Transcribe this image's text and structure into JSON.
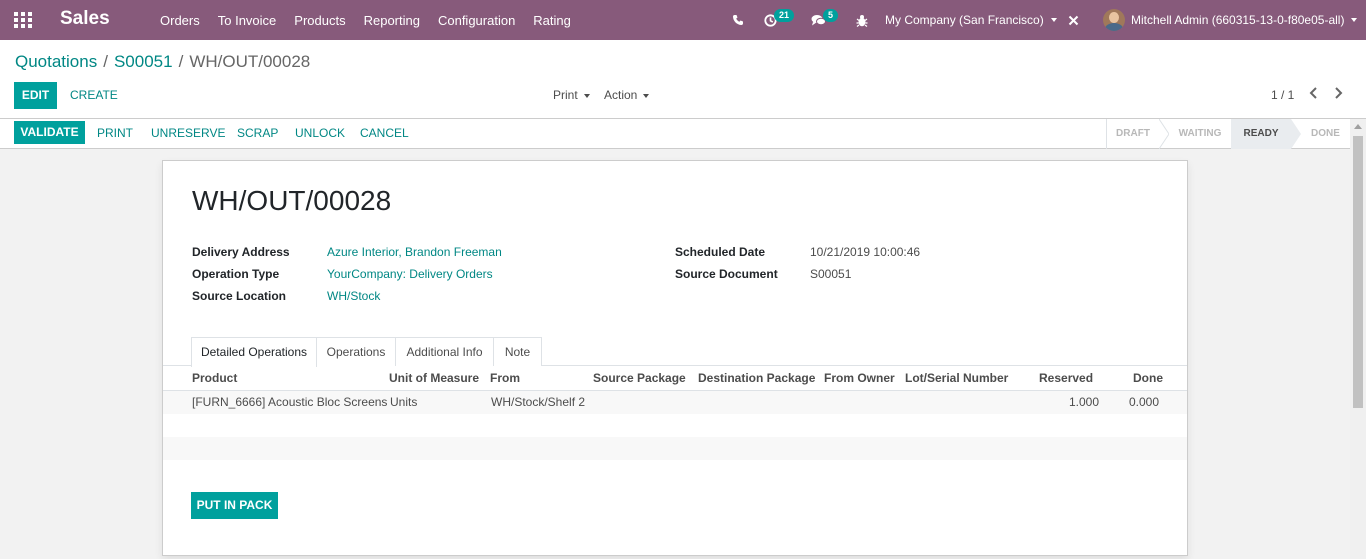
{
  "navbar": {
    "app_name": "Sales",
    "menu": [
      "Orders",
      "To Invoice",
      "Products",
      "Reporting",
      "Configuration",
      "Rating"
    ],
    "activity_count": "21",
    "message_count": "5",
    "company": "My Company (San Francisco)",
    "user": "Mitchell Admin (660315-13-0-f80e05-all)",
    "accent_color": "#875a7b"
  },
  "breadcrumb": {
    "items": [
      "Quotations",
      "S00051"
    ],
    "current": "WH/OUT/00028"
  },
  "control_panel": {
    "edit_label": "EDIT",
    "create_label": "CREATE",
    "print_label": "Print",
    "action_label": "Action",
    "pager": "1 / 1"
  },
  "statusbar": {
    "validate_label": "VALIDATE",
    "buttons": [
      "PRINT",
      "UNRESERVE",
      "SCRAP",
      "UNLOCK",
      "CANCEL"
    ],
    "stages": [
      "DRAFT",
      "WAITING",
      "READY",
      "DONE"
    ],
    "active_stage": "READY"
  },
  "form": {
    "title": "WH/OUT/00028",
    "fields": {
      "delivery_address_label": "Delivery Address",
      "delivery_address": "Azure Interior, Brandon Freeman",
      "operation_type_label": "Operation Type",
      "operation_type": "YourCompany: Delivery Orders",
      "source_location_label": "Source Location",
      "source_location": "WH/Stock",
      "scheduled_date_label": "Scheduled Date",
      "scheduled_date": "10/21/2019 10:00:46",
      "source_document_label": "Source Document",
      "source_document": "S00051"
    },
    "tabs": [
      "Detailed Operations",
      "Operations",
      "Additional Info",
      "Note"
    ],
    "active_tab": "Detailed Operations",
    "table": {
      "headers": [
        "Product",
        "Unit of Measure",
        "From",
        "Source Package",
        "Destination Package",
        "From Owner",
        "Lot/Serial Number",
        "Reserved",
        "Done"
      ],
      "rows": [
        {
          "product": "[FURN_6666] Acoustic Bloc Screens",
          "uom": "Units",
          "from": "WH/Stock/Shelf 2",
          "source_package": "",
          "destination_package": "",
          "from_owner": "",
          "lot": "",
          "reserved": "1.000",
          "done": "0.000"
        }
      ]
    },
    "put_in_pack_label": "PUT IN PACK"
  }
}
